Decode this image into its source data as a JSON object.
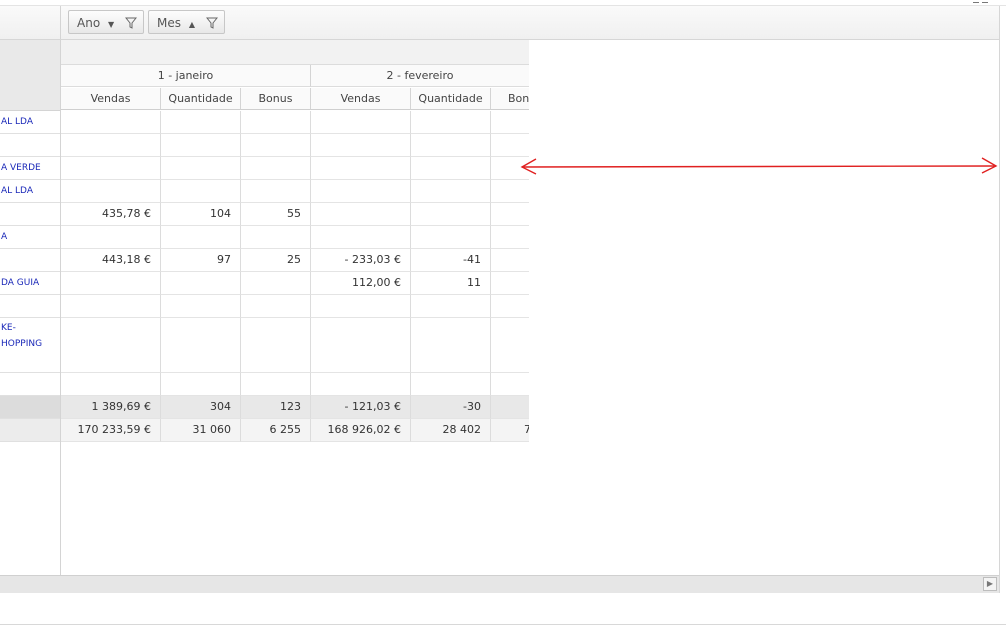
{
  "toolbar": {
    "fields": [
      {
        "label": "Ano",
        "sort": "▼",
        "icon": "filter-icon"
      },
      {
        "label": "Mes",
        "sort": "▲",
        "icon": "filter-icon"
      }
    ]
  },
  "colors": {
    "link": "#1a28b8",
    "arrow": "#e02020",
    "subtotal_bg": "#e8e8e8"
  },
  "columns": {
    "months": [
      "1 - janeiro",
      "2 - fevereiro"
    ],
    "measures": [
      "Vendas",
      "Quantidade",
      "Bonus",
      "Vendas",
      "Quantidade",
      "Bon"
    ]
  },
  "row_labels": [
    {
      "text": "AL LDA"
    },
    {
      "text": ""
    },
    {
      "text": "A VERDE"
    },
    {
      "text": "AL LDA"
    },
    {
      "text": ""
    },
    {
      "text": "A"
    },
    {
      "text": ""
    },
    {
      "text": "DA GUIA"
    },
    {
      "text": ""
    },
    {
      "text": "KE-\nHOPPING"
    },
    {
      "text": ""
    },
    {
      "text": ""
    },
    {
      "text": ""
    }
  ],
  "rows": [
    [
      "",
      "",
      "",
      "",
      "",
      ""
    ],
    [
      "",
      "",
      "",
      "",
      "",
      ""
    ],
    [
      "",
      "",
      "",
      "",
      "",
      ""
    ],
    [
      "",
      "",
      "",
      "",
      "",
      ""
    ],
    [
      "435,78 €",
      "104",
      "55",
      "",
      "",
      ""
    ],
    [
      "",
      "",
      "",
      "",
      "",
      ""
    ],
    [
      "443,18 €",
      "97",
      "25",
      "- 233,03 €",
      "-41",
      ""
    ],
    [
      "",
      "",
      "",
      "112,00 €",
      "11",
      ""
    ],
    [
      "",
      "",
      "",
      "",
      "",
      ""
    ],
    [
      "",
      "",
      "",
      "",
      "",
      ""
    ],
    [
      "",
      "",
      "",
      "",
      "",
      ""
    ],
    [
      "1 389,69 €",
      "304",
      "123",
      "- 121,03 €",
      "-30",
      ""
    ],
    [
      "170 233,59 €",
      "31 060",
      "6 255",
      "168 926,02 €",
      "28 402",
      "7"
    ]
  ]
}
